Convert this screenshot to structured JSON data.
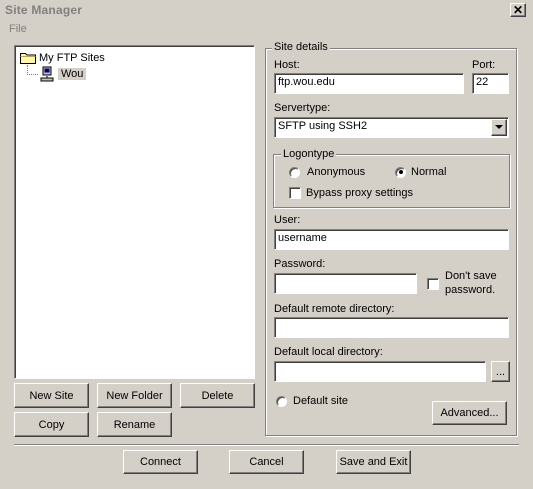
{
  "window": {
    "title": "Site Manager",
    "close_glyph": "✕"
  },
  "menu": {
    "file": "File"
  },
  "tree": {
    "root_label": "My FTP Sites",
    "child_label": "Wou",
    "root_icon": "folder-icon",
    "child_icon": "computer-icon"
  },
  "left_buttons": {
    "new_site": "New Site",
    "new_folder": "New Folder",
    "delete": "Delete",
    "copy": "Copy",
    "rename": "Rename"
  },
  "site_details": {
    "group_label": "Site details",
    "host_label": "Host:",
    "host_value": "ftp.wou.edu",
    "port_label": "Port:",
    "port_value": "22",
    "servertype_label": "Servertype:",
    "servertype_value": "SFTP using SSH2",
    "logontype_label": "Logontype",
    "anonymous_label": "Anonymous",
    "normal_label": "Normal",
    "logontype_selected": "Normal",
    "bypass_proxy_label": "Bypass proxy settings",
    "bypass_proxy_checked": false,
    "user_label": "User:",
    "user_value": "username",
    "password_label": "Password:",
    "password_value": "",
    "dont_save_label_1": "Don't save",
    "dont_save_label_2": "password.",
    "dont_save_checked": false,
    "remote_dir_label": "Default remote directory:",
    "remote_dir_value": "",
    "local_dir_label": "Default local directory:",
    "local_dir_value": "",
    "browse_label": "...",
    "default_site_label": "Default site",
    "default_site_selected": false,
    "advanced_label": "Advanced..."
  },
  "bottom_buttons": {
    "connect": "Connect",
    "cancel": "Cancel",
    "save_exit": "Save and Exit"
  }
}
